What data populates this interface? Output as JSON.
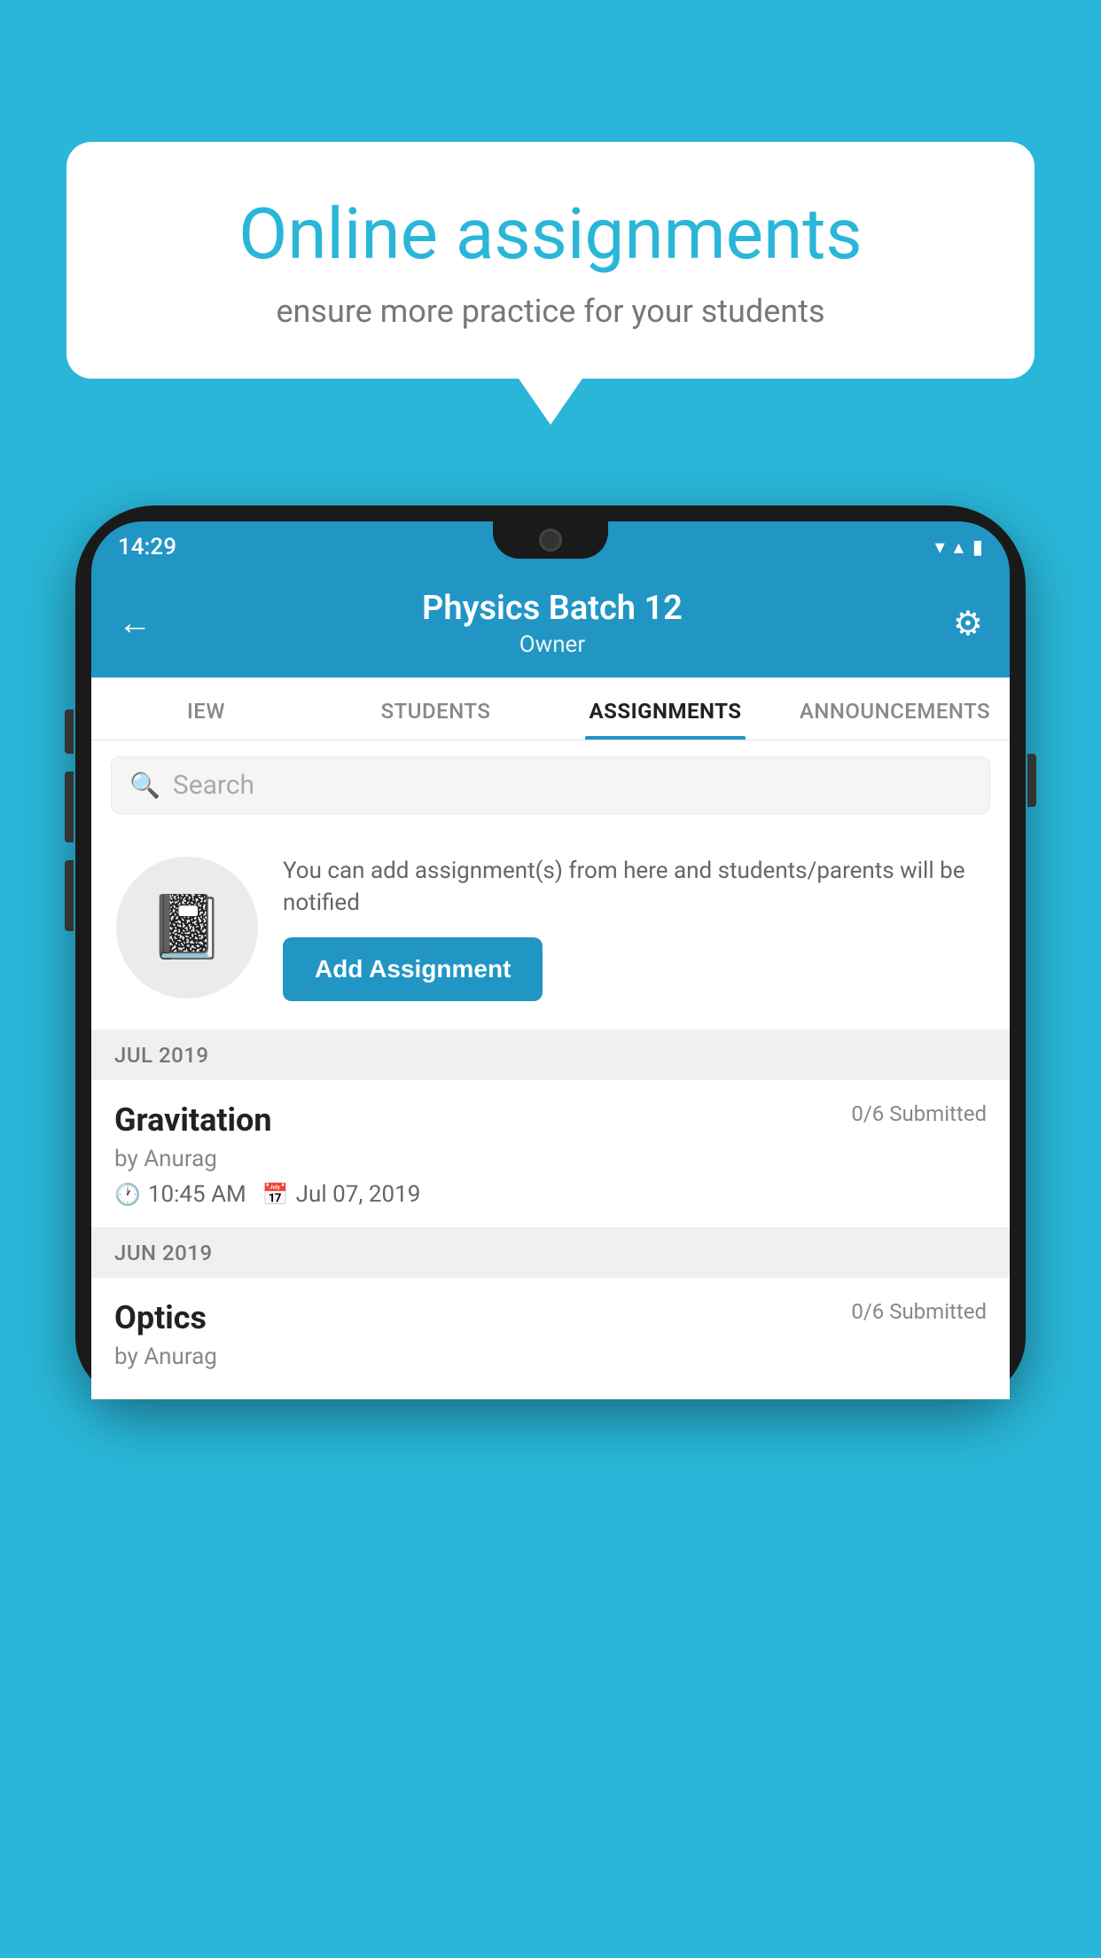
{
  "background_color": "#29B6D8",
  "speech_bubble": {
    "title": "Online assignments",
    "subtitle": "ensure more practice for your students"
  },
  "status_bar": {
    "time": "14:29",
    "wifi": "▾",
    "signal": "▴",
    "battery": "▮"
  },
  "header": {
    "title": "Physics Batch 12",
    "subtitle": "Owner",
    "back_label": "←",
    "settings_label": "⚙"
  },
  "tabs": [
    {
      "label": "IEW",
      "active": false
    },
    {
      "label": "STUDENTS",
      "active": false
    },
    {
      "label": "ASSIGNMENTS",
      "active": true
    },
    {
      "label": "ANNOUNCEMENTS",
      "active": false
    }
  ],
  "search": {
    "placeholder": "Search"
  },
  "promo": {
    "description": "You can add assignment(s) from here and students/parents will be notified",
    "button_label": "Add Assignment"
  },
  "sections": [
    {
      "month_label": "JUL 2019",
      "assignments": [
        {
          "name": "Gravitation",
          "submitted": "0/6 Submitted",
          "author": "by Anurag",
          "time": "10:45 AM",
          "date": "Jul 07, 2019"
        }
      ]
    },
    {
      "month_label": "JUN 2019",
      "assignments": [
        {
          "name": "Optics",
          "submitted": "0/6 Submitted",
          "author": "by Anurag",
          "time": "",
          "date": ""
        }
      ]
    }
  ]
}
